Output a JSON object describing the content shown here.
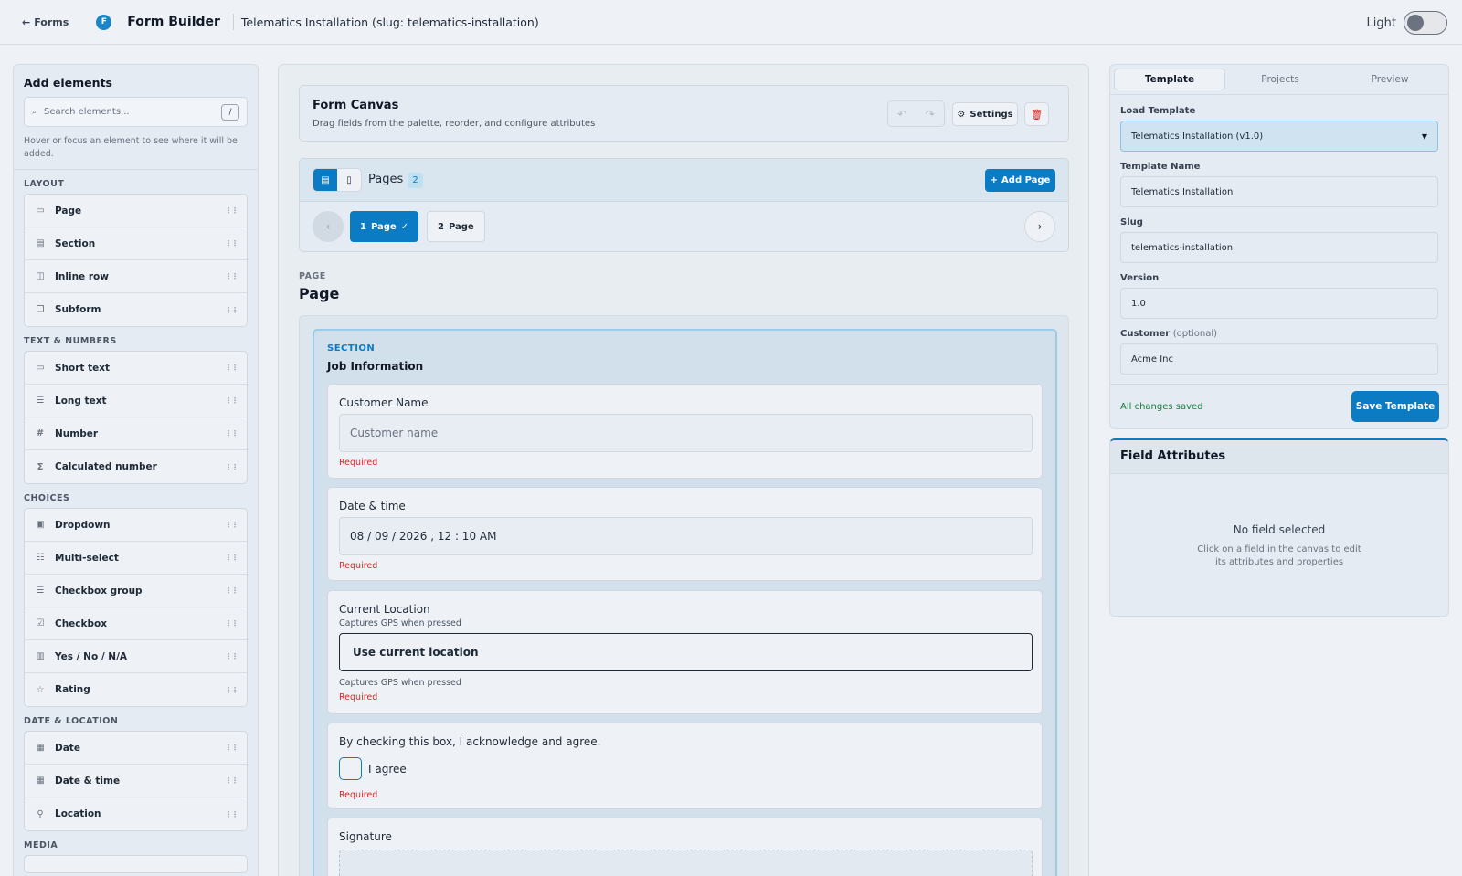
{
  "topbar": {
    "back_label": "Forms",
    "app_name": "Form Builder",
    "form_title": "Telematics Installation (slug: telematics-installation)",
    "theme_label": "Light"
  },
  "palette": {
    "title": "Add elements",
    "search_placeholder": "Search elements...",
    "search_shortcut": "/",
    "hint": "Hover or focus an element to see where it will be added.",
    "categories": [
      {
        "label": "LAYOUT",
        "items": [
          "Page",
          "Section",
          "Inline row",
          "Subform"
        ]
      },
      {
        "label": "TEXT & NUMBERS",
        "items": [
          "Short text",
          "Long text",
          "Number",
          "Calculated number"
        ]
      },
      {
        "label": "CHOICES",
        "items": [
          "Dropdown",
          "Multi-select",
          "Checkbox group",
          "Checkbox",
          "Yes / No / N/A",
          "Rating"
        ]
      },
      {
        "label": "DATE & LOCATION",
        "items": [
          "Date",
          "Date & time",
          "Location"
        ]
      },
      {
        "label": "MEDIA",
        "items": []
      }
    ]
  },
  "canvas": {
    "title": "Form Canvas",
    "subtitle": "Drag fields from the palette, reorder, and configure attributes",
    "settings_label": "Settings",
    "pages_label": "Pages",
    "pages_count": "2",
    "add_page_label": "Add Page",
    "page_tabs": [
      {
        "num": "1",
        "label": "Page"
      },
      {
        "num": "2",
        "label": "Page"
      }
    ],
    "page_kicker": "PAGE",
    "page_heading": "Page",
    "section_kicker": "SECTION",
    "section_title": "Job Information",
    "fields": {
      "customer_name": {
        "label": "Customer Name",
        "placeholder": "Customer name",
        "required": "Required"
      },
      "date_time": {
        "label": "Date & time",
        "value": "08 / 09 / 2026 ,  12 : 10   AM",
        "required": "Required"
      },
      "location": {
        "label": "Current Location",
        "help": "Captures GPS when pressed",
        "button": "Use current location",
        "help2": "Captures GPS when pressed",
        "required": "Required"
      },
      "agree": {
        "label": "By checking this box, I acknowledge and agree.",
        "option": "I agree",
        "required": "Required"
      },
      "signature": {
        "label": "Signature"
      }
    }
  },
  "template_panel": {
    "tabs": [
      "Template",
      "Projects",
      "Preview"
    ],
    "load_label": "Load Template",
    "load_value": "Telematics Installation (v1.0)",
    "name_label": "Template Name",
    "name_value": "Telematics Installation",
    "slug_label": "Slug",
    "slug_value": "telematics-installation",
    "version_label": "Version",
    "version_value": "1.0",
    "customer_label": "Customer",
    "customer_optional": "(optional)",
    "customer_value": "Acme Inc",
    "status": "All changes saved",
    "save_label": "Save Template"
  },
  "attributes_panel": {
    "title": "Field Attributes",
    "empty_title": "No field selected",
    "empty_desc": "Click on a field in the canvas to edit its attributes and properties"
  },
  "colors": {
    "accent": "#0b7bc3",
    "danger": "#dc2626",
    "success": "#15803d"
  }
}
